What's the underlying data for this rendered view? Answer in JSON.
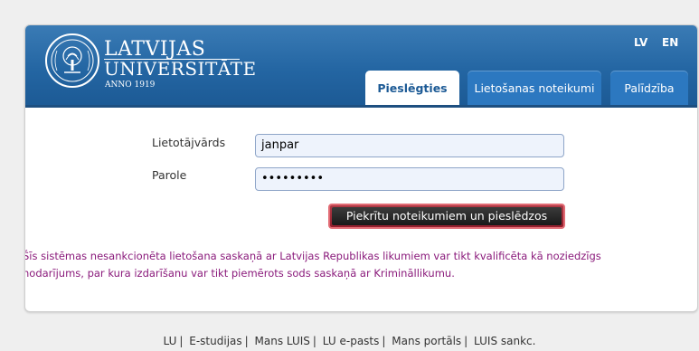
{
  "header": {
    "brand_line1": "LATVIJAS",
    "brand_line2": "UNIVERSITĀTE",
    "brand_line3": "ANNO 1919",
    "languages": [
      "LV",
      "EN"
    ]
  },
  "tabs": [
    {
      "label": "Pieslēgties",
      "active": true
    },
    {
      "label": "Lietošanas noteikumi",
      "active": false
    },
    {
      "label": "Palīdzība",
      "active": false
    }
  ],
  "form": {
    "username_label": "Lietotājvārds",
    "username_value": "janpar",
    "password_label": "Parole",
    "password_value": "•••••••••",
    "submit_label": "Piekrītu noteikumiem un pieslēdzos"
  },
  "warning": "Šīs sistēmas nesankcionēta lietošana saskaņā ar Latvijas Republikas likumiem var tikt kvalificēta kā noziedzīgs nodarījums, par kura izdarīšanu var tikt piemērots sods saskaņā ar Krimināllikumu.",
  "footer_links": [
    "LU",
    "E-studijas",
    "Mans LUIS",
    "LU e-pasts",
    "Mans portāls",
    "LUIS sankc."
  ],
  "colors": {
    "header_blue": "#2466a3",
    "tab_blue": "#2c78c0",
    "warning_text": "#8a1a7b",
    "button_border": "#e16b74"
  }
}
